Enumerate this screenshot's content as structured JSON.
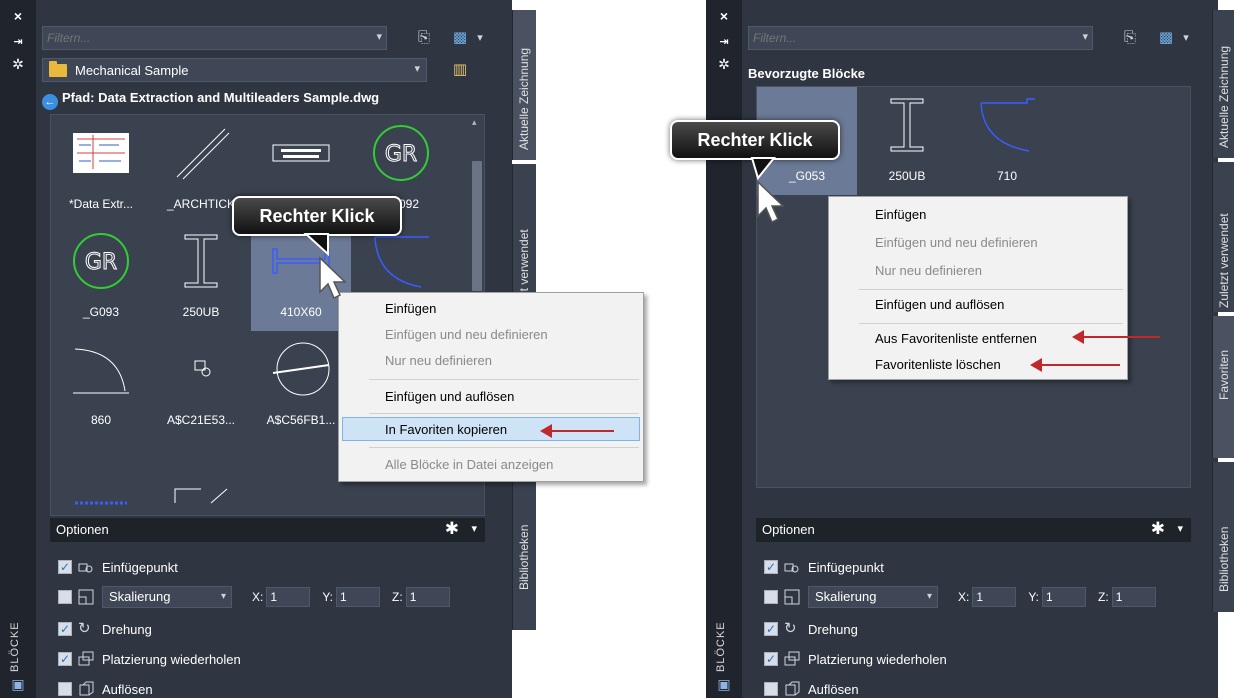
{
  "left_panel": {
    "side_title": "BLÖCKE",
    "filter_placeholder": "Filtern...",
    "library_name": "Mechanical Sample",
    "path_label": "Pfad: Data Extraction and Multileaders Sample.dwg",
    "tiles": [
      {
        "caption": "*Data Extr...",
        "icon": "data-extraction-thumbnail"
      },
      {
        "caption": "_ARCHTICK",
        "icon": "diagonal-tick-thumbnail"
      },
      {
        "caption": "",
        "icon": "issued-for-construction-stamp-thumbnail"
      },
      {
        "caption": "_G092",
        "icon": "gr-circle-thumbnail"
      },
      {
        "caption": "_G093",
        "icon": "gr-circle-thumbnail"
      },
      {
        "caption": "250UB",
        "icon": "i-beam-thumbnail"
      },
      {
        "caption": "410X60",
        "icon": "h-beam-thumbnail"
      },
      {
        "caption": "",
        "icon": "arc-thumbnail"
      },
      {
        "caption": "860",
        "icon": "door-arc-thumbnail"
      },
      {
        "caption": "A$C21E53...",
        "icon": "small-block-thumbnail"
      },
      {
        "caption": "A$C56FB1...",
        "icon": "circle-section-thumbnail"
      },
      {
        "caption": "",
        "icon": "blank-thumbnail"
      }
    ],
    "options_title": "Optionen",
    "options": {
      "insertion_point": "Einfügepunkt",
      "scale_dropdown": "Skalierung",
      "x_label": "X:",
      "x_value": "1",
      "y_label": "Y:",
      "y_value": "1",
      "z_label": "Z:",
      "z_value": "1",
      "rotation": "Drehung",
      "repeat_placement": "Platzierung wiederholen",
      "explode": "Auflösen"
    },
    "tabs": [
      "Aktuelle Zeichnung",
      "Zuletzt verwendet",
      "Bibliotheken"
    ],
    "callout": "Rechter Klick",
    "context_menu": {
      "insert": "Einfügen",
      "insert_redefine": "Einfügen und neu definieren",
      "redefine_only": "Nur neu definieren",
      "insert_explode": "Einfügen und auflösen",
      "copy_to_favorites": "In Favoriten kopieren",
      "show_all_blocks": "Alle Blöcke in Datei anzeigen"
    }
  },
  "right_panel": {
    "side_title": "BLÖCKE",
    "filter_placeholder": "Filtern...",
    "section_title": "Bevorzugte Blöcke",
    "tiles": [
      {
        "caption": "_G053",
        "icon": "blank-thumbnail"
      },
      {
        "caption": "250UB",
        "icon": "i-beam-thumbnail"
      },
      {
        "caption": "710",
        "icon": "door-arc-thumbnail"
      }
    ],
    "options_title": "Optionen",
    "options": {
      "insertion_point": "Einfügepunkt",
      "scale_dropdown": "Skalierung",
      "x_label": "X:",
      "x_value": "1",
      "y_label": "Y:",
      "y_value": "1",
      "z_label": "Z:",
      "z_value": "1",
      "rotation": "Drehung",
      "repeat_placement": "Platzierung wiederholen",
      "explode": "Auflösen"
    },
    "tabs": [
      "Aktuelle Zeichnung",
      "Zuletzt verwendet",
      "Favoriten",
      "Bibliotheken"
    ],
    "callout": "Rechter Klick",
    "context_menu": {
      "insert": "Einfügen",
      "insert_redefine": "Einfügen und neu definieren",
      "redefine_only": "Nur neu definieren",
      "insert_explode": "Einfügen und auflösen",
      "remove_from_favorites": "Aus Favoritenliste entfernen",
      "clear_favorites": "Favoritenliste löschen"
    }
  },
  "colors": {
    "panel_bg": "#2f3642",
    "accent_arrow": "#c0282b",
    "selected_tile": "#6b7a96",
    "menu_highlight": "#cfe3f7"
  }
}
